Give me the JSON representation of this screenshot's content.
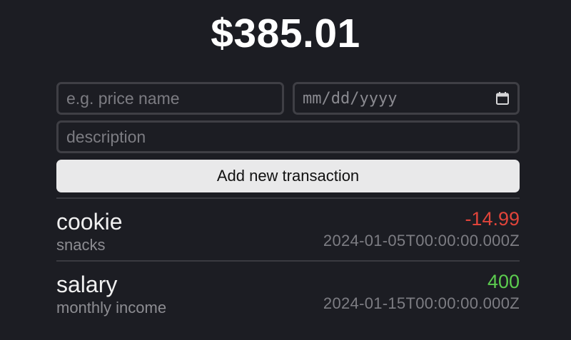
{
  "balance": "$385.01",
  "form": {
    "name_placeholder": "e.g. price name",
    "date_placeholder": "mm/dd/yyyy",
    "description_placeholder": "description",
    "submit_label": "Add new transaction"
  },
  "transactions": [
    {
      "name": "cookie",
      "description": "snacks",
      "amount": "-14.99",
      "date": "2024-01-05T00:00:00.000Z",
      "amount_color": "#e0443a"
    },
    {
      "name": "salary",
      "description": "monthly income",
      "amount": "400",
      "date": "2024-01-15T00:00:00.000Z",
      "amount_color": "#5ccc4f"
    }
  ],
  "icons": {
    "date_picker": "calendar-icon"
  }
}
